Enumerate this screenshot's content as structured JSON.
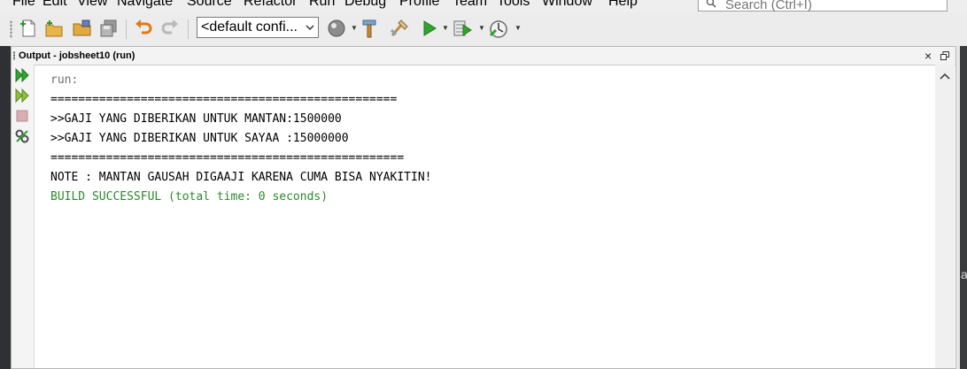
{
  "menubar": {
    "items": [
      "File",
      "Edit",
      "View",
      "Navigate",
      "Source",
      "Refactor",
      "Run",
      "Debug",
      "Profile",
      "Team",
      "Tools",
      "Window",
      "Help"
    ],
    "search_placeholder": "Search (Ctrl+I)"
  },
  "toolbar": {
    "config_value": "<default confi...",
    "icons": [
      "new-file-icon",
      "new-project-icon",
      "open-project-icon",
      "save-all-icon",
      "undo-icon",
      "redo-icon",
      "clean-build-icon",
      "build-icon",
      "run-icon",
      "debug-icon",
      "profile-icon"
    ]
  },
  "output": {
    "title": "Output - jobsheet10 (run)",
    "close_label": "×",
    "lines": [
      "run:",
      "==================================================",
      ">>GAJI YANG DIBERIKAN UNTUK MANTAN:1500000",
      ">>GAJI YANG DIBERIKAN UNTUK SAYAA :15000000",
      "===================================================",
      "NOTE : MANTAN GAUSAH DIGAAJI KARENA CUMA BISA NYAKITIN!",
      "BUILD SUCCESSFUL (total time: 0 seconds)"
    ]
  },
  "edge_fragment": "a",
  "colors": {
    "success": "#2a8a2a",
    "run_text": "#6e6e6e",
    "run_icon": "#2fa52f"
  }
}
